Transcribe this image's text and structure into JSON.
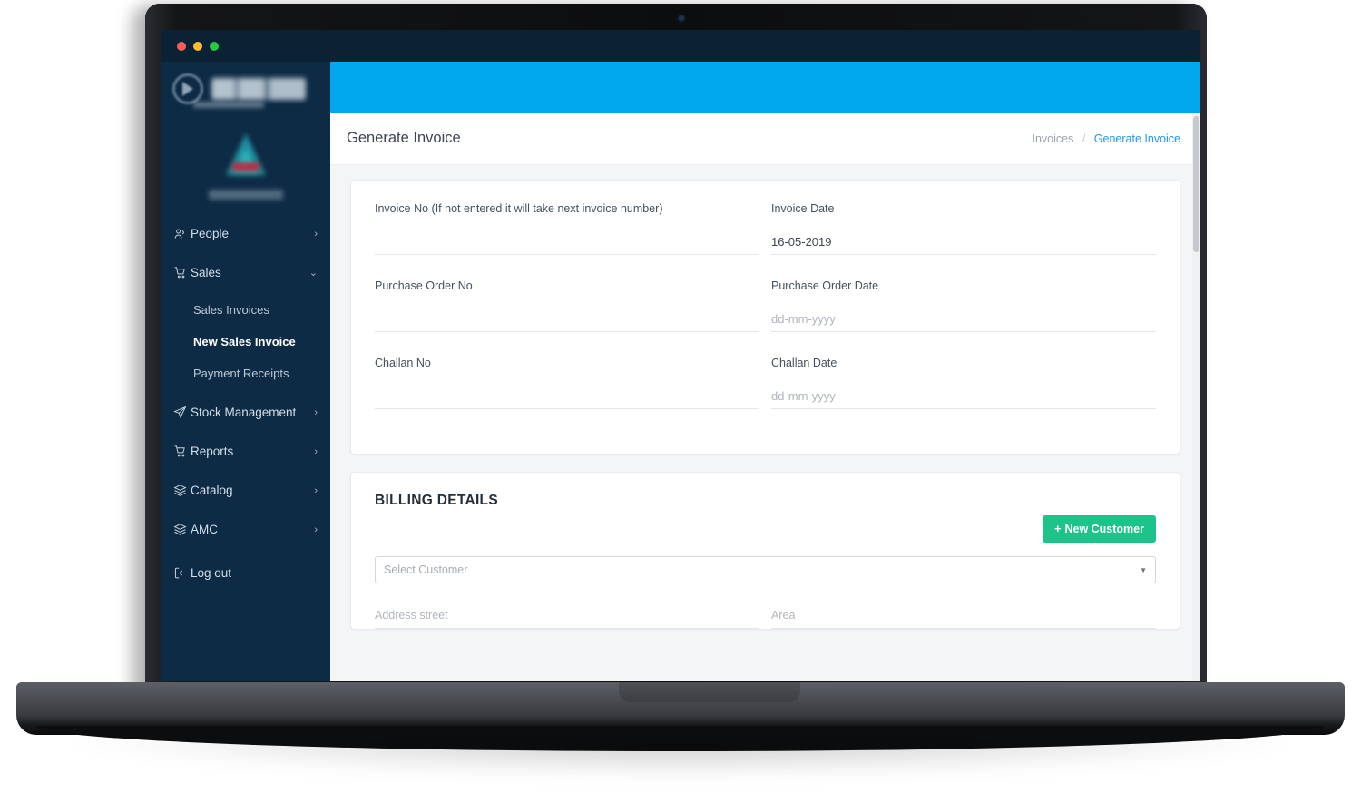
{
  "window": {
    "titlebar_color": "#0b2134",
    "traffic_lights": [
      "close",
      "minimize",
      "maximize"
    ]
  },
  "sidebar": {
    "bg_color": "#0e2b45",
    "brand_blurred": true,
    "items": [
      {
        "label": "People",
        "icon": "people-icon",
        "chevron": "›",
        "expanded": false
      },
      {
        "label": "Sales",
        "icon": "cart-icon",
        "chevron": "⌄",
        "expanded": true
      },
      {
        "label": "Stock Management",
        "icon": "paper-plane-icon",
        "chevron": "›",
        "expanded": false
      },
      {
        "label": "Reports",
        "icon": "cart-icon",
        "chevron": "›",
        "expanded": false
      },
      {
        "label": "Catalog",
        "icon": "layers-icon",
        "chevron": "›",
        "expanded": false
      },
      {
        "label": "AMC",
        "icon": "layers-icon",
        "chevron": "›",
        "expanded": false
      }
    ],
    "sales_subitems": [
      {
        "label": "Sales Invoices",
        "active": false
      },
      {
        "label": "New Sales Invoice",
        "active": true
      },
      {
        "label": "Payment Receipts",
        "active": false
      }
    ],
    "logout": {
      "label": "Log out",
      "icon": "logout-icon"
    }
  },
  "header": {
    "banner_color": "#00a7ec",
    "title": "Generate Invoice",
    "breadcrumb": {
      "parent": "Invoices",
      "separator": "/",
      "current": "Generate Invoice",
      "current_color": "#2196f3"
    }
  },
  "invoice_form": {
    "fields": [
      {
        "label": "Invoice No (If not entered it will take next invoice number)",
        "value": "",
        "placeholder": ""
      },
      {
        "label": "Invoice Date",
        "value": "16-05-2019",
        "placeholder": ""
      },
      {
        "label": "Purchase Order No",
        "value": "",
        "placeholder": ""
      },
      {
        "label": "Purchase Order Date",
        "value": "",
        "placeholder": "dd-mm-yyyy"
      },
      {
        "label": "Challan No",
        "value": "",
        "placeholder": ""
      },
      {
        "label": "Challan Date",
        "value": "",
        "placeholder": "dd-mm-yyyy"
      }
    ]
  },
  "billing": {
    "title": "BILLING DETAILS",
    "new_customer_button": {
      "label": "New Customer",
      "plus": "+",
      "color": "#1dc488"
    },
    "customer_select": {
      "value": "Select Customer",
      "caret": "▼"
    },
    "address_fields": [
      {
        "placeholder": "Address street"
      },
      {
        "placeholder": "Area"
      }
    ]
  }
}
